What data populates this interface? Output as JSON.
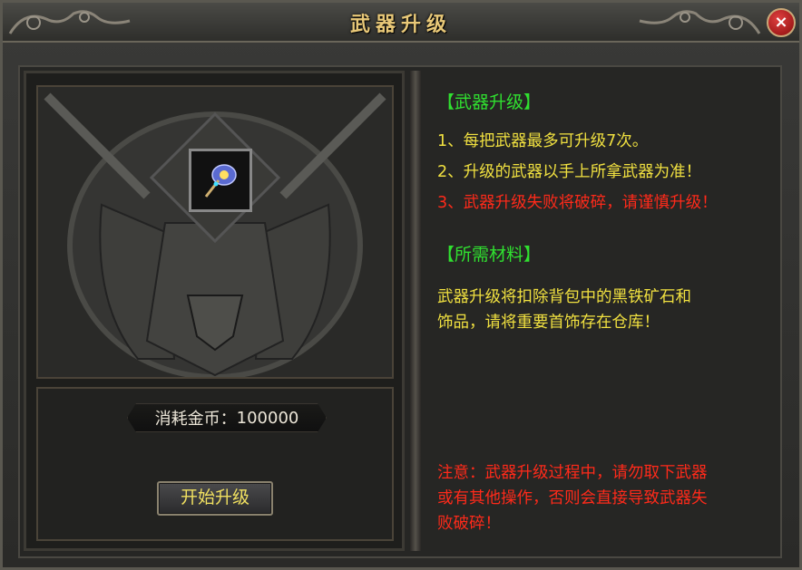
{
  "window": {
    "title": "武器升级",
    "close_label": "×"
  },
  "left": {
    "cost_label": "消耗金币：",
    "cost_value": "100000",
    "upgrade_button": "开始升级"
  },
  "right": {
    "section1_title": "【武器升级】",
    "rule1": "1、每把武器最多可升级7次。",
    "rule2": "2、升级的武器以手上所拿武器为准！",
    "rule3": "3、武器升级失败将破碎，请谨慎升级！",
    "section2_title": "【所需材料】",
    "material_line1": "武器升级将扣除背包中的黑铁矿石和",
    "material_line2": "饰品，请将重要首饰存在仓库！",
    "warn_line1": "注意：武器升级过程中，请勿取下武器",
    "warn_line2": "或有其他操作，否则会直接导致武器失",
    "warn_line3": "败破碎！"
  },
  "colors": {
    "title": "#e8c878",
    "green": "#30e030",
    "yellow": "#f0e040",
    "red": "#ff2a1a"
  },
  "icons": {
    "slot_item": "staff-weapon-icon",
    "close": "close-icon"
  }
}
